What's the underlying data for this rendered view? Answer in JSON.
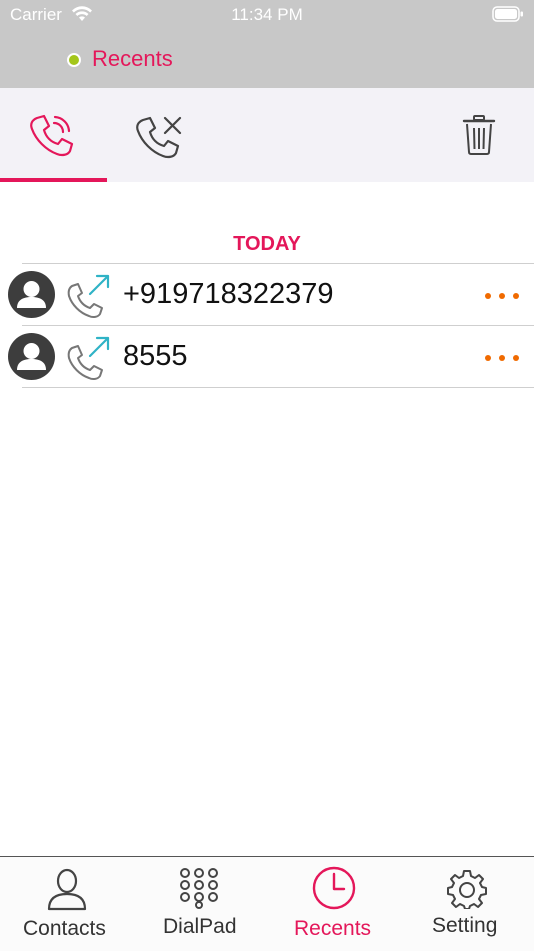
{
  "status_bar": {
    "carrier": "Carrier",
    "time": "11:34 PM"
  },
  "header": {
    "title": "Recents",
    "status_color": "#a4c61a"
  },
  "segments": [
    {
      "name": "all-calls",
      "icon": "phone-icon",
      "active": true
    },
    {
      "name": "missed-calls",
      "icon": "phone-missed-icon",
      "active": false
    },
    {
      "name": "delete",
      "icon": "trash-icon",
      "active": false
    }
  ],
  "section": {
    "header": "TODAY"
  },
  "calls": [
    {
      "number": "+919718322379",
      "direction": "outgoing",
      "icon": "outgoing-call-icon"
    },
    {
      "number": "8555",
      "direction": "outgoing",
      "icon": "outgoing-call-icon"
    }
  ],
  "tabbar": {
    "items": [
      {
        "label": "Contacts",
        "icon": "person-icon",
        "active": false
      },
      {
        "label": "DialPad",
        "icon": "dialpad-icon",
        "active": false
      },
      {
        "label": "Recents",
        "icon": "clock-icon",
        "active": true
      },
      {
        "label": "Setting",
        "icon": "gear-icon",
        "active": false
      }
    ]
  },
  "colors": {
    "accent": "#e4175a",
    "more_dots": "#f06a00",
    "outgoing_arrow": "#2fb3c6",
    "header_bg": "#c8c8c8"
  }
}
